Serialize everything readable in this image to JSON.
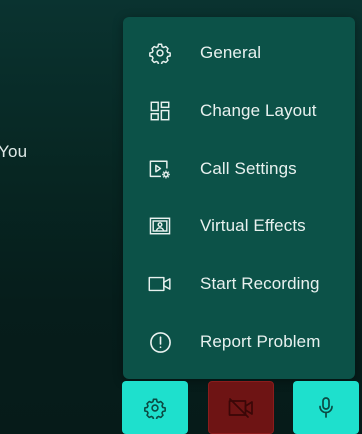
{
  "participant": {
    "self_label": "You"
  },
  "menu": {
    "items": [
      {
        "label": "General",
        "icon": "gear-icon"
      },
      {
        "label": "Change Layout",
        "icon": "layout-grid-icon"
      },
      {
        "label": "Call Settings",
        "icon": "call-settings-icon"
      },
      {
        "label": "Virtual Effects",
        "icon": "virtual-background-icon"
      },
      {
        "label": "Start Recording",
        "icon": "video-camera-icon"
      },
      {
        "label": "Report Problem",
        "icon": "alert-circle-icon"
      }
    ]
  },
  "toolbar": {
    "settings_icon": "gear-icon",
    "video_icon": "video-off-icon",
    "video_state": "off",
    "mic_icon": "microphone-icon",
    "mic_state": "on"
  },
  "colors": {
    "menu_background": "#0c5248",
    "accent": "#1ee0cd",
    "video_off": "#6e1414",
    "background": "#072622"
  }
}
